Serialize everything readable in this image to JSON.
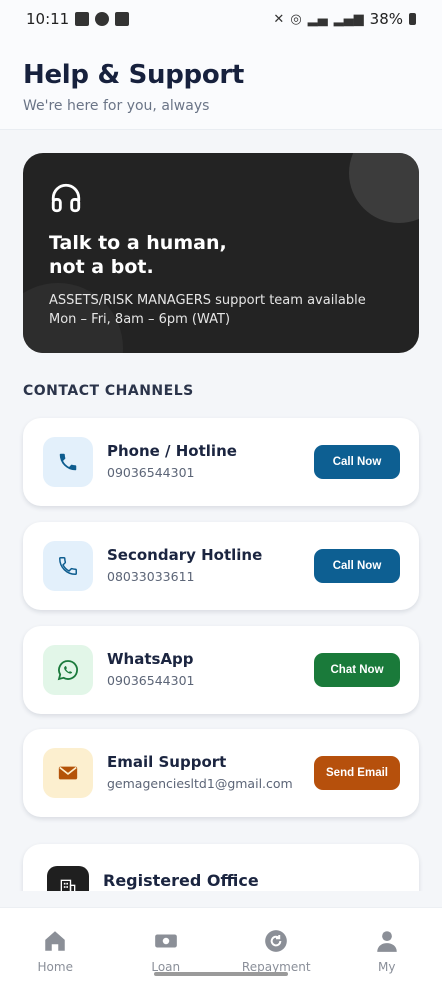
{
  "status_bar": {
    "time": "10:11",
    "battery": "38%"
  },
  "header": {
    "title": "Help & Support",
    "subtitle": "We're here for you, always"
  },
  "hero": {
    "icon": "headphones-icon",
    "title_line1": "Talk to a human,",
    "title_line2": "not a bot.",
    "desc_line1": "ASSETS/RISK MANAGERS support team available",
    "desc_line2": "Mon – Fri, 8am – 6pm (WAT)"
  },
  "section_title": "CONTACT CHANNELS",
  "channels": [
    {
      "title": "Phone / Hotline",
      "value": "09036544301",
      "button": "Call Now",
      "icon": "phone-icon",
      "icon_bg": "#e3f0fb",
      "icon_color": "#0e5d8f",
      "button_color": "#0d5f92"
    },
    {
      "title": "Secondary Hotline",
      "value": "08033033611",
      "button": "Call Now",
      "icon": "phone-outline-icon",
      "icon_bg": "#e3f0fb",
      "icon_color": "#0e5d8f",
      "button_color": "#0d5f92"
    },
    {
      "title": "WhatsApp",
      "value": "09036544301",
      "button": "Chat Now",
      "icon": "whatsapp-icon",
      "icon_bg": "#e2f6e8",
      "icon_color": "#1b7a3c",
      "button_color": "#1a7a3a"
    },
    {
      "title": "Email Support",
      "value": "gemagenciesltd1@gmail.com",
      "button": "Send Email",
      "icon": "mail-icon",
      "icon_bg": "#fcefcf",
      "icon_color": "#b45309",
      "button_color": "#b6500c"
    }
  ],
  "office": {
    "title": "Registered Office",
    "icon": "building-icon"
  },
  "nav": [
    {
      "label": "Home",
      "icon": "home-icon"
    },
    {
      "label": "Loan",
      "icon": "cash-icon"
    },
    {
      "label": "Repayment",
      "icon": "refresh-icon"
    },
    {
      "label": "My",
      "icon": "person-icon"
    }
  ]
}
